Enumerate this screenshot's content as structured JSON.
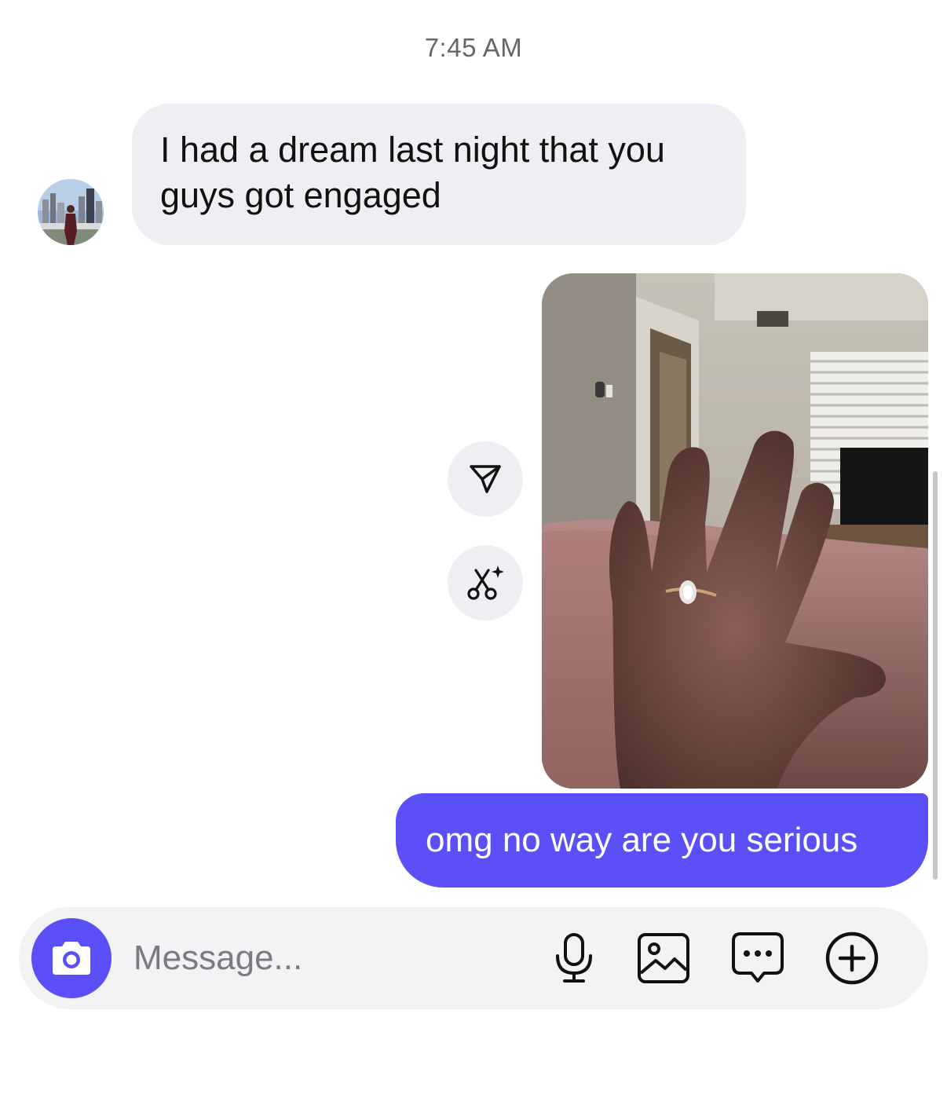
{
  "thread": {
    "timestamp": "7:45 AM"
  },
  "messages": {
    "incoming_text": "I had a dream last night that you guys got engaged",
    "outgoing_text": "omg no way are you serious"
  },
  "composer": {
    "placeholder": "Message..."
  },
  "icons": {
    "share": "paper-plane-icon",
    "remix": "scissors-sparkle-icon",
    "camera": "camera-icon",
    "mic": "microphone-icon",
    "gallery": "image-icon",
    "sticker": "chat-dots-icon",
    "more": "plus-circle-icon"
  },
  "colors": {
    "accent": "#5b4ff8",
    "incoming_bubble": "#efeff3",
    "composer_bg": "#f3f3f6"
  }
}
